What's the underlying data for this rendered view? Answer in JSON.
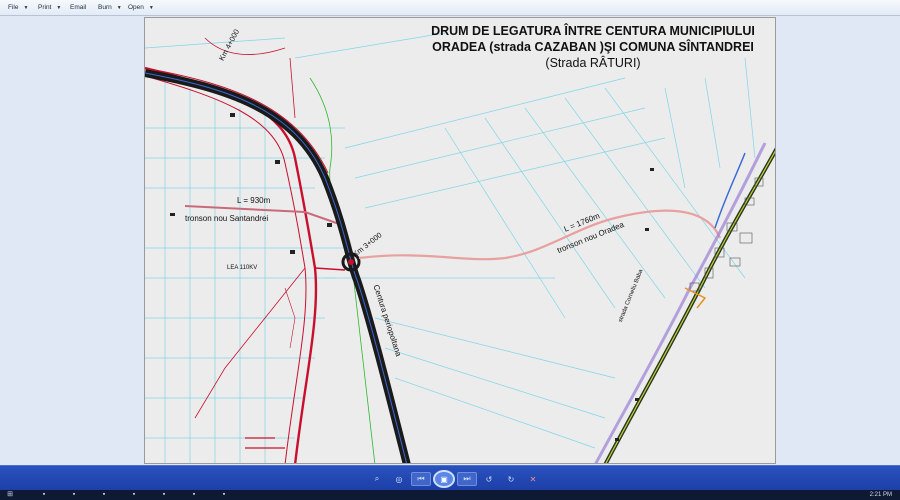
{
  "menubar": {
    "items": [
      {
        "label": "File",
        "has_dropdown": true
      },
      {
        "label": "Print",
        "has_dropdown": true
      },
      {
        "label": "Email",
        "has_dropdown": false
      },
      {
        "label": "Burn",
        "has_dropdown": true
      },
      {
        "label": "Open",
        "has_dropdown": true
      }
    ],
    "caret": "▼"
  },
  "map": {
    "title_line1": "DRUM DE LEGATURA ÎNTRE CENTURA MUNICIPIULUI",
    "title_line2": "ORADEA (strada CAZABAN )ŞI COMUNA SÎNTANDREI",
    "title_line3": "(Strada RÂTURI)",
    "labels": {
      "km4": "Km 4+000",
      "km3": "Km 3+000",
      "l930": "L = 930m",
      "tronson_santandrei": "tronson nou Santandrei",
      "lea": "LEA 110KV",
      "l1760": "L = 1760m",
      "tronson_oradea": "tronson nou Oradea",
      "centura": "Centura periopoltana",
      "strada": "strada Corneliu Baba"
    }
  },
  "bottombar": {
    "controls": [
      {
        "name": "zoom-icon",
        "glyph": "⌕"
      },
      {
        "name": "actual-size-icon",
        "glyph": "◎"
      },
      {
        "name": "previous-icon",
        "glyph": "⏮"
      },
      {
        "name": "slideshow-icon",
        "glyph": "▣"
      },
      {
        "name": "next-icon",
        "glyph": "⏭"
      },
      {
        "name": "rotate-left-icon",
        "glyph": "↺"
      },
      {
        "name": "rotate-right-icon",
        "glyph": "↻"
      },
      {
        "name": "delete-icon",
        "glyph": "✕"
      }
    ]
  },
  "taskbar": {
    "clock": "2:21 PM"
  },
  "colors": {
    "road_red": "#c8102e",
    "highway_dark": "#1a1a1a",
    "highway_edge": "#3a6ad8",
    "new_road": "#e58a8a",
    "parcel_lines": "#6fd3e6",
    "bottombar_blue": "#1f46b4"
  }
}
